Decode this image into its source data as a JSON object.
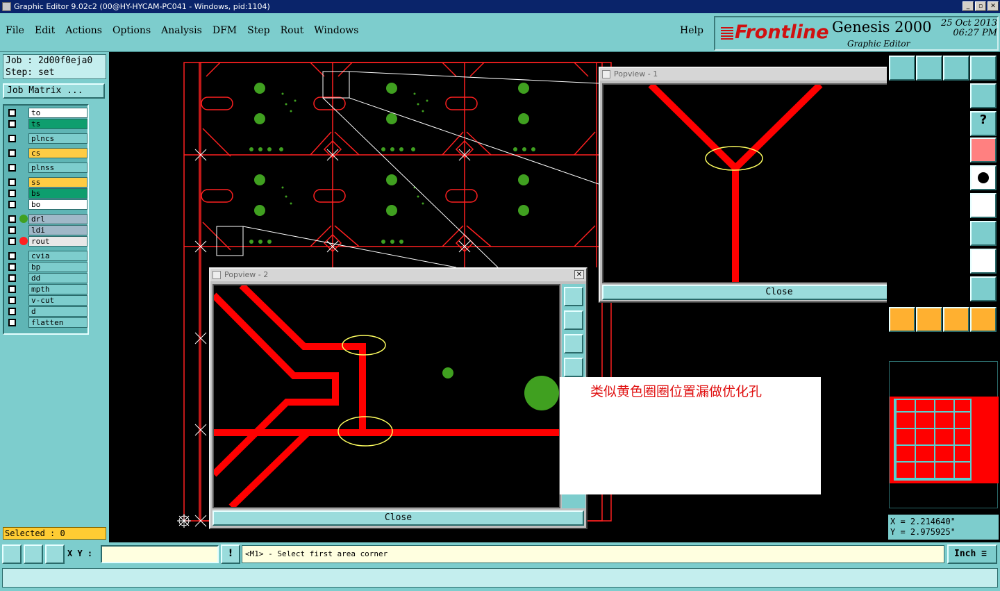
{
  "window": {
    "title": "Graphic Editor 9.02c2 (00@HY-HYCAM-PC041 - Windows, pid:1104)"
  },
  "menu": {
    "items": [
      "File",
      "Edit",
      "Actions",
      "Options",
      "Analysis",
      "DFM",
      "Step",
      "Rout",
      "Windows"
    ],
    "help": "Help"
  },
  "brand": {
    "logo": "Frontline",
    "product": "Genesis 2000",
    "subtitle": "Graphic Editor",
    "date": "25 Oct 2013",
    "time": "06:27 PM"
  },
  "job": {
    "job_line": "Job : 2d00f0eja0",
    "step_line": "Step: set",
    "matrix_button": "Job Matrix ..."
  },
  "layers": [
    {
      "name": "to",
      "color": "#ffffff"
    },
    {
      "name": "ts",
      "color": "#0e9e6e"
    },
    {
      "name": "plncs",
      "color": "#7dcdcd"
    },
    {
      "name": "cs",
      "color": "#ffcc44"
    },
    {
      "name": "plnss",
      "color": "#7dcdcd"
    },
    {
      "name": "ss",
      "color": "#ffcc44"
    },
    {
      "name": "bs",
      "color": "#0e9e6e"
    },
    {
      "name": "bo",
      "color": "#ffffff"
    },
    {
      "name": "drl",
      "color": "#a0b8c8",
      "dot": "#40a020"
    },
    {
      "name": "ldi",
      "color": "#a0b8c8"
    },
    {
      "name": "rout",
      "color": "#e8e8e8",
      "dot": "#ff2020"
    },
    {
      "name": "cvia",
      "color": "#7dcdcd"
    },
    {
      "name": "bp",
      "color": "#7dcdcd"
    },
    {
      "name": "dd",
      "color": "#7dcdcd"
    },
    {
      "name": "mpth",
      "color": "#7dcdcd"
    },
    {
      "name": "v-cut",
      "color": "#7dcdcd"
    },
    {
      "name": "d",
      "color": "#7dcdcd"
    },
    {
      "name": "flatten",
      "color": "#7dcdcd"
    }
  ],
  "selected_text": "Selected : 0",
  "popview1": {
    "title": "Popview - 1",
    "close_label": "Close"
  },
  "popview2": {
    "title": "Popview - 2",
    "close_label": "Close"
  },
  "annotation": "类似黄色圈圈位置漏做优化孔",
  "coords": {
    "x": "X = 2.214640\"",
    "y": "Y = 2.975925\""
  },
  "bottom": {
    "xy_label": "X Y :",
    "message": "<M1> - Select first area corner",
    "units": "Inch"
  },
  "colors": {
    "panel": "#7dcdcd",
    "trace": "#ff0000",
    "pad": "#40a020",
    "highlight_ellipse": "#ffff60"
  }
}
